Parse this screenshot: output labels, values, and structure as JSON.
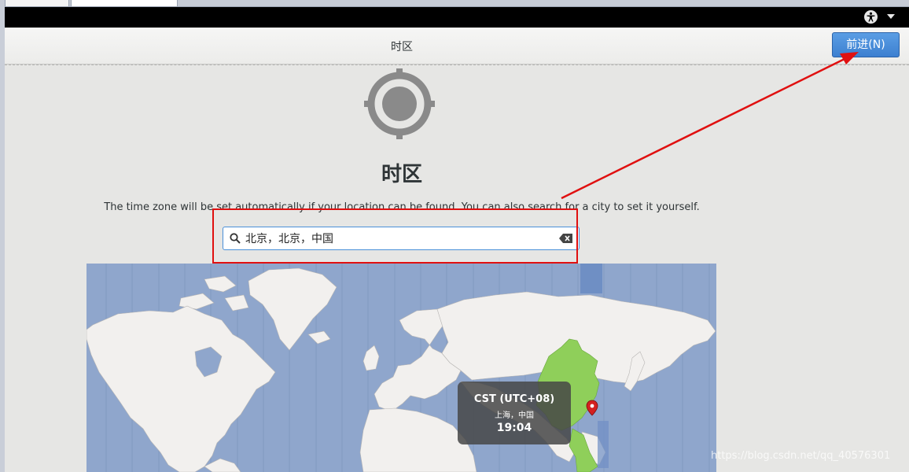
{
  "header": {
    "title": "时区",
    "next_button": "前进(N)"
  },
  "page": {
    "title": "时区",
    "description": "The time zone will be set automatically if your location can be found. You can also search for a city to set it yourself."
  },
  "search": {
    "value": "北京，北京，中国"
  },
  "tooltip": {
    "zone": "CST (UTC+08)",
    "city": "上海，中国",
    "time": "19:04"
  },
  "watermark": "https://blog.csdn.net/qq_40576301",
  "icons": {
    "accessibility": "accessibility-icon",
    "dropdown": "chevron-down-icon",
    "locate": "location-target-icon",
    "search": "search-icon",
    "clear": "clear-text-icon",
    "pin": "map-pin-icon"
  },
  "colors": {
    "accent": "#3c7fd0",
    "ocean": "#8fa6cc",
    "land": "#f2f0ee",
    "selected_zone": "#8fcf5a",
    "annotation": "#e01010"
  }
}
